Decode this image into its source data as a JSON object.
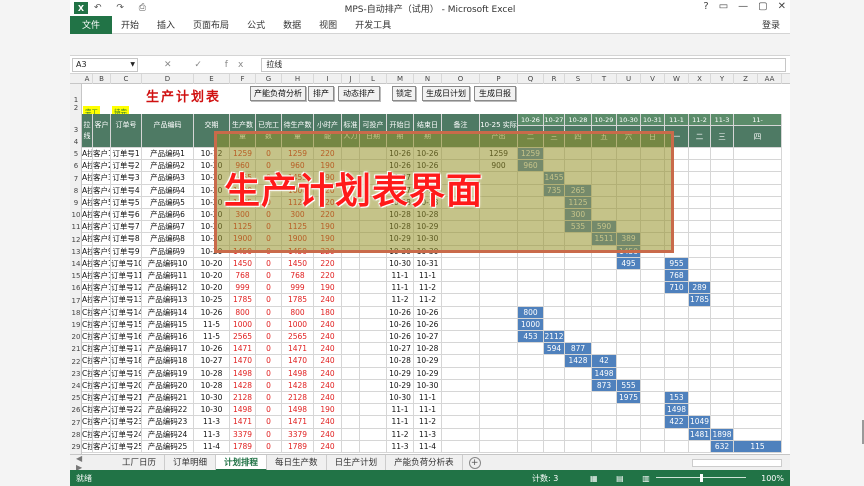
{
  "window": {
    "title": "MPS-自动排产（试用） - Microsoft Excel",
    "controls": [
      "?",
      "▭",
      "—",
      "▢",
      "✕"
    ],
    "logo": "X",
    "quick_access": "↶ ↷ ⎙"
  },
  "ribbon": {
    "file": "文件",
    "tabs": [
      "开始",
      "插入",
      "页面布局",
      "公式",
      "数据",
      "视图",
      "开发工具"
    ],
    "login": "登录"
  },
  "formula_bar": {
    "namebox": "A3",
    "fx_icons": "✕ ✓ fx",
    "value": "拉线"
  },
  "sheet": {
    "title": "生产计划表",
    "yellow_tags": [
      "完工",
      "待完"
    ],
    "buttons": [
      "产能负荷分析",
      "排产",
      "动态排产",
      "锁定",
      "生成日计划",
      "生成日报"
    ],
    "columns": [
      "A",
      "B",
      "C",
      "D",
      "E",
      "F",
      "G",
      "H",
      "I",
      "J",
      "L",
      "M",
      "N",
      "O",
      "P",
      "Q",
      "R",
      "S",
      "T",
      "U",
      "V",
      "W",
      "X",
      "Y",
      "Z",
      "AA"
    ],
    "row_numbers": [
      "1",
      "2",
      "3",
      "4",
      "5",
      "6",
      "7",
      "8",
      "9",
      "10",
      "11",
      "12",
      "13",
      "14",
      "15",
      "16",
      "17",
      "18",
      "19",
      "20",
      "21",
      "22",
      "23",
      "24",
      "25",
      "26",
      "27",
      "28",
      "29"
    ],
    "headers": [
      "拉线",
      "客户",
      "订单号",
      "产品编码",
      "交期",
      "生产数量",
      "已完工数",
      "待生产数量",
      "小时产能",
      "标准人力",
      "可投产日期",
      "开始日期",
      "结束日期",
      "备注",
      "10-25 实际产出"
    ],
    "date_headers": [
      "10-26",
      "10-27",
      "10-28",
      "10-29",
      "10-30",
      "10-31",
      "11-1",
      "11-2",
      "11-3",
      "11-"
    ],
    "weekday_headers": [
      "二",
      "三",
      "四",
      "五",
      "六",
      "日",
      "一",
      "二",
      "三",
      "四"
    ],
    "rows": [
      {
        "line": "A拉",
        "client": "客户1",
        "order": "订单号1",
        "product": "产品编码1",
        "due": "10-12",
        "qty": "1259",
        "done": "0",
        "todo": "1259",
        "cap": "220",
        "start": "10-26",
        "end": "10-26",
        "actual": "1259"
      },
      {
        "line": "A拉",
        "client": "客户2",
        "order": "订单号2",
        "product": "产品编码2",
        "due": "10-20",
        "qty": "960",
        "done": "0",
        "todo": "960",
        "cap": "190",
        "start": "10-26",
        "end": "10-26",
        "actual": "900"
      },
      {
        "line": "A拉",
        "client": "客户3",
        "order": "订单号3",
        "product": "产品编码3",
        "due": "10-20",
        "qty": "1455",
        "done": "0",
        "todo": "1455",
        "cap": "190",
        "start": "10-27",
        "end": "10-27",
        "actual": ""
      },
      {
        "line": "A拉",
        "client": "客户4",
        "order": "订单号4",
        "product": "产品编码4",
        "due": "10-20",
        "qty": "1000",
        "done": "0",
        "todo": "1000",
        "cap": "220",
        "start": "10-27",
        "end": "10-28",
        "actual": ""
      },
      {
        "line": "A拉",
        "client": "客户5",
        "order": "订单号5",
        "product": "产品编码5",
        "due": "10-20",
        "qty": "1125",
        "done": "0",
        "todo": "1125",
        "cap": "220",
        "start": "10-28",
        "end": "10-28",
        "actual": ""
      },
      {
        "line": "A拉",
        "client": "客户6",
        "order": "订单号6",
        "product": "产品编码6",
        "due": "10-20",
        "qty": "300",
        "done": "0",
        "todo": "300",
        "cap": "220",
        "start": "10-28",
        "end": "10-28",
        "actual": ""
      },
      {
        "line": "A拉",
        "client": "客户7",
        "order": "订单号7",
        "product": "产品编码7",
        "due": "10-20",
        "qty": "1125",
        "done": "0",
        "todo": "1125",
        "cap": "190",
        "start": "10-28",
        "end": "10-29",
        "actual": ""
      },
      {
        "line": "A拉",
        "client": "客户8",
        "order": "订单号8",
        "product": "产品编码8",
        "due": "10-20",
        "qty": "1900",
        "done": "0",
        "todo": "1900",
        "cap": "190",
        "start": "10-29",
        "end": "10-30",
        "actual": ""
      },
      {
        "line": "A拉",
        "client": "客户9",
        "order": "订单号9",
        "product": "产品编码9",
        "due": "10-20",
        "qty": "1450",
        "done": "0",
        "todo": "1450",
        "cap": "220",
        "start": "10-30",
        "end": "10-30",
        "actual": ""
      },
      {
        "line": "A拉",
        "client": "客户10",
        "order": "订单号10",
        "product": "产品编码10",
        "due": "10-20",
        "qty": "1450",
        "done": "0",
        "todo": "1450",
        "cap": "220",
        "start": "10-30",
        "end": "10-31",
        "actual": ""
      },
      {
        "line": "A拉",
        "client": "客户11",
        "order": "订单号11",
        "product": "产品编码11",
        "due": "10-20",
        "qty": "768",
        "done": "0",
        "todo": "768",
        "cap": "220",
        "start": "11-1",
        "end": "11-1",
        "actual": ""
      },
      {
        "line": "A拉",
        "client": "客户12",
        "order": "订单号12",
        "product": "产品编码12",
        "due": "10-20",
        "qty": "999",
        "done": "0",
        "todo": "999",
        "cap": "190",
        "start": "11-1",
        "end": "11-2",
        "actual": ""
      },
      {
        "line": "A拉",
        "client": "客户13",
        "order": "订单号13",
        "product": "产品编码13",
        "due": "10-25",
        "qty": "1785",
        "done": "0",
        "todo": "1785",
        "cap": "240",
        "start": "11-2",
        "end": "11-2",
        "actual": ""
      },
      {
        "line": "C拉",
        "client": "客户14",
        "order": "订单号14",
        "product": "产品编码14",
        "due": "10-26",
        "qty": "800",
        "done": "0",
        "todo": "800",
        "cap": "180",
        "start": "10-26",
        "end": "10-26",
        "actual": ""
      },
      {
        "line": "C拉",
        "client": "客户15",
        "order": "订单号15",
        "product": "产品编码15",
        "due": "11-5",
        "qty": "1000",
        "done": "0",
        "todo": "1000",
        "cap": "240",
        "start": "10-26",
        "end": "10-26",
        "actual": ""
      },
      {
        "line": "C拉",
        "client": "客户16",
        "order": "订单号16",
        "product": "产品编码16",
        "due": "11-5",
        "qty": "2565",
        "done": "0",
        "todo": "2565",
        "cap": "240",
        "start": "10-26",
        "end": "10-27",
        "actual": ""
      },
      {
        "line": "C拉",
        "client": "客户17",
        "order": "订单号17",
        "product": "产品编码17",
        "due": "10-26",
        "qty": "1471",
        "done": "0",
        "todo": "1471",
        "cap": "240",
        "start": "10-27",
        "end": "10-28",
        "actual": ""
      },
      {
        "line": "C拉",
        "client": "客户18",
        "order": "订单号18",
        "product": "产品编码18",
        "due": "10-27",
        "qty": "1470",
        "done": "0",
        "todo": "1470",
        "cap": "240",
        "start": "10-28",
        "end": "10-29",
        "actual": ""
      },
      {
        "line": "C拉",
        "client": "客户19",
        "order": "订单号19",
        "product": "产品编码19",
        "due": "10-28",
        "qty": "1498",
        "done": "0",
        "todo": "1498",
        "cap": "240",
        "start": "10-29",
        "end": "10-29",
        "actual": ""
      },
      {
        "line": "C拉",
        "client": "客户20",
        "order": "订单号20",
        "product": "产品编码20",
        "due": "10-28",
        "qty": "1428",
        "done": "0",
        "todo": "1428",
        "cap": "240",
        "start": "10-29",
        "end": "10-30",
        "actual": ""
      },
      {
        "line": "C拉",
        "client": "客户21",
        "order": "订单号21",
        "product": "产品编码21",
        "due": "10-30",
        "qty": "2128",
        "done": "0",
        "todo": "2128",
        "cap": "240",
        "start": "10-30",
        "end": "11-1",
        "actual": ""
      },
      {
        "line": "C拉",
        "client": "客户22",
        "order": "订单号22",
        "product": "产品编码22",
        "due": "10-30",
        "qty": "1498",
        "done": "0",
        "todo": "1498",
        "cap": "190",
        "start": "11-1",
        "end": "11-1",
        "actual": ""
      },
      {
        "line": "C拉",
        "client": "客户23",
        "order": "订单号23",
        "product": "产品编码23",
        "due": "11-3",
        "qty": "1471",
        "done": "0",
        "todo": "1471",
        "cap": "240",
        "start": "11-1",
        "end": "11-2",
        "actual": ""
      },
      {
        "line": "C拉",
        "client": "客户24",
        "order": "订单号24",
        "product": "产品编码24",
        "due": "11-3",
        "qty": "3379",
        "done": "0",
        "todo": "3379",
        "cap": "240",
        "start": "11-2",
        "end": "11-3",
        "actual": ""
      },
      {
        "line": "C拉",
        "client": "客户25",
        "order": "订单号25",
        "product": "产品编码25",
        "due": "11-4",
        "qty": "1789",
        "done": "0",
        "todo": "1789",
        "cap": "240",
        "start": "11-3",
        "end": "11-4",
        "actual": ""
      }
    ],
    "gantt": [
      [
        [
          0,
          "1259"
        ]
      ],
      [
        [
          0,
          "960"
        ]
      ],
      [
        [
          1,
          "1455"
        ]
      ],
      [
        [
          1,
          "735"
        ],
        [
          2,
          "265"
        ]
      ],
      [
        [
          2,
          "1125"
        ]
      ],
      [
        [
          2,
          "300"
        ]
      ],
      [
        [
          2,
          "535"
        ],
        [
          3,
          "590"
        ]
      ],
      [
        [
          3,
          "1511"
        ],
        [
          4,
          "389"
        ]
      ],
      [
        [
          4,
          "1450"
        ]
      ],
      [
        [
          4,
          "495"
        ],
        [
          6,
          "955"
        ]
      ],
      [
        [
          6,
          "768"
        ]
      ],
      [
        [
          6,
          "710"
        ],
        [
          7,
          "289"
        ]
      ],
      [
        [
          7,
          "1785"
        ]
      ],
      [
        [
          0,
          "800"
        ]
      ],
      [
        [
          0,
          "1000"
        ]
      ],
      [
        [
          0,
          "453"
        ],
        [
          1,
          "2112"
        ]
      ],
      [
        [
          1,
          "594"
        ],
        [
          2,
          "877"
        ]
      ],
      [
        [
          2,
          "1428"
        ],
        [
          3,
          "42"
        ]
      ],
      [
        [
          3,
          "1498"
        ]
      ],
      [
        [
          3,
          "873"
        ],
        [
          4,
          "555"
        ]
      ],
      [
        [
          4,
          "1975"
        ],
        [
          6,
          "153"
        ]
      ],
      [
        [
          6,
          "1498"
        ]
      ],
      [
        [
          6,
          "422"
        ],
        [
          7,
          "1049"
        ]
      ],
      [
        [
          7,
          "1481"
        ],
        [
          8,
          "1898"
        ]
      ],
      [
        [
          8,
          "632"
        ],
        [
          9,
          "115"
        ]
      ]
    ]
  },
  "overlay": {
    "caption": "生产计划表界面"
  },
  "sheet_tabs": {
    "nav": "◀ ▶",
    "tabs": [
      "工厂日历",
      "订单明细",
      "计划排程",
      "每日生产数",
      "日生产计划",
      "产能负荷分析表"
    ],
    "active": "计划排程",
    "add": "+"
  },
  "status": {
    "ready": "就绪",
    "count": "计数: 3",
    "views": "▦ ▤ ▥",
    "zoom": "100%"
  }
}
